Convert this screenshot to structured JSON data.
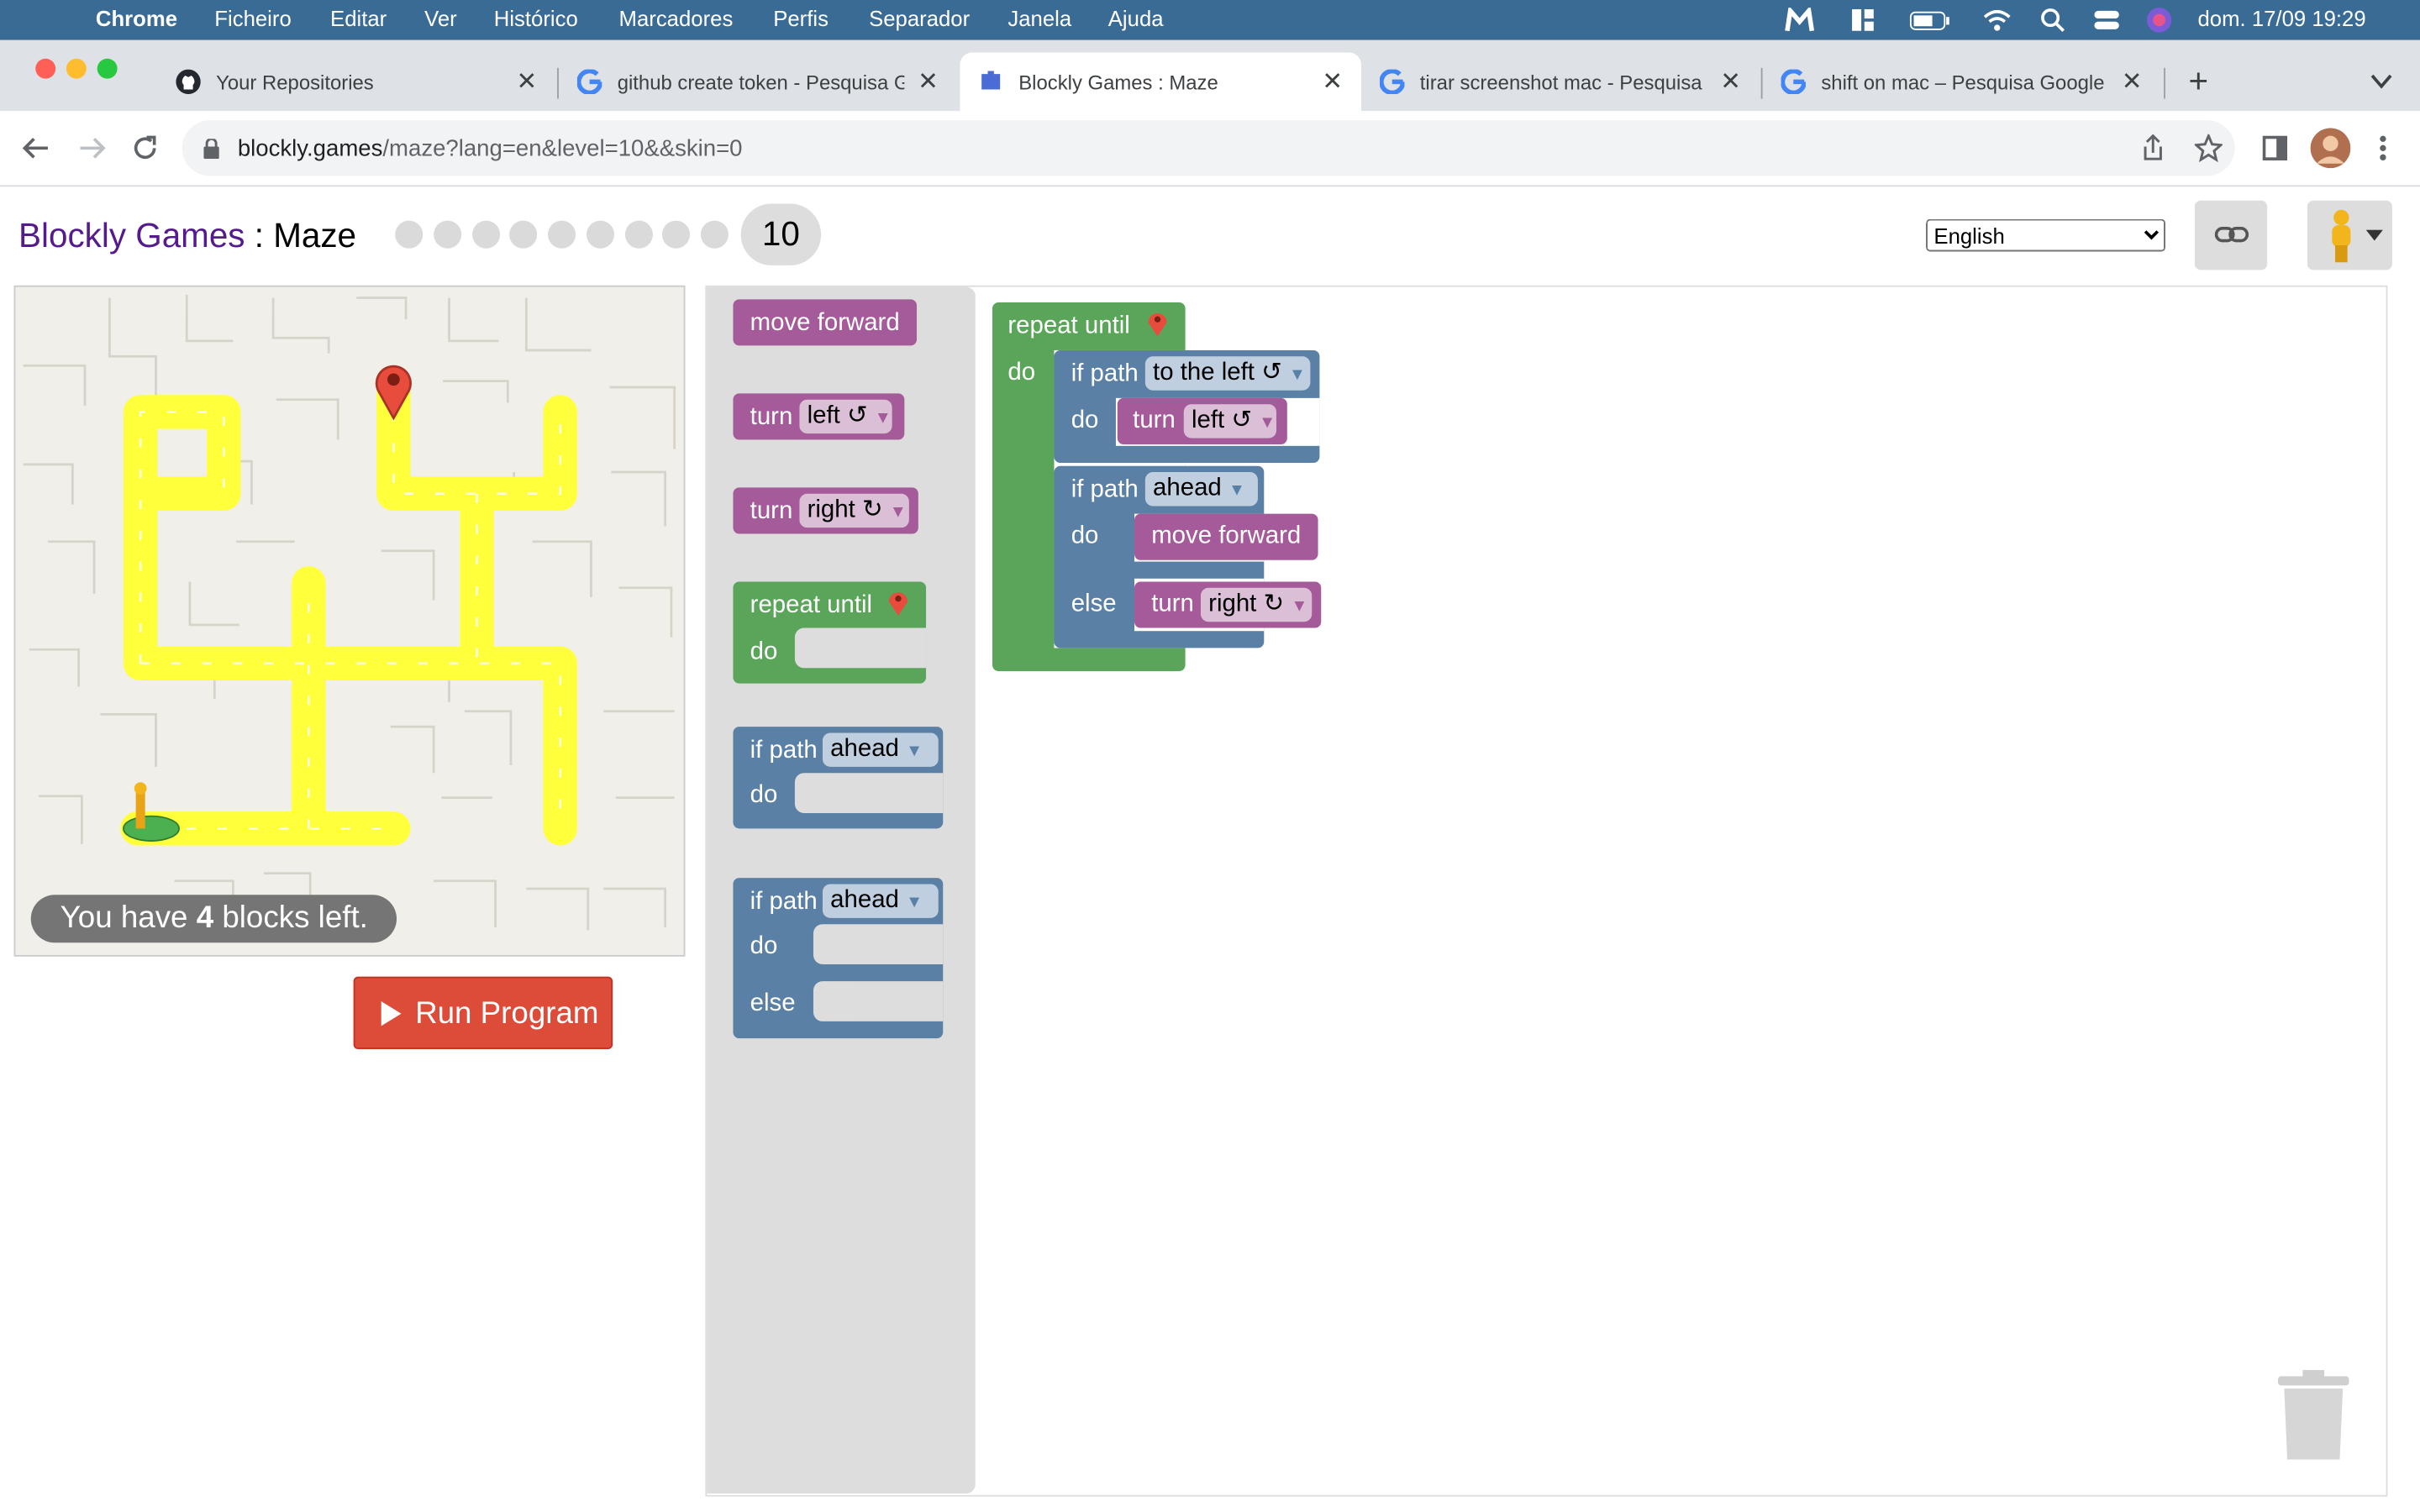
{
  "menubar": {
    "app": "Chrome",
    "items": [
      "Ficheiro",
      "Editar",
      "Ver",
      "Histórico",
      "Marcadores",
      "Perfis",
      "Separador",
      "Janela",
      "Ajuda"
    ],
    "clock": "dom. 17/09  19:29"
  },
  "tabs": [
    {
      "title": "Your Repositories",
      "icon": "github-icon"
    },
    {
      "title": "github create token - Pesquisa Google",
      "icon": "google-icon"
    },
    {
      "title": "Blockly Games : Maze",
      "icon": "blockly-icon",
      "active": true
    },
    {
      "title": "tirar screenshot mac - Pesquisa Google",
      "icon": "google-icon"
    },
    {
      "title": "shift on mac – Pesquisa Google",
      "icon": "google-icon"
    }
  ],
  "toolbar": {
    "url_host": "blockly.games",
    "url_path": "/maze?lang=en&level=10&&skin=0"
  },
  "page": {
    "title_link": "Blockly Games",
    "title_sep": " : ",
    "title_name": "Maze",
    "level": "10",
    "language": "English",
    "capacity_prefix": "You have ",
    "capacity_count": "4",
    "capacity_suffix": " blocks left.",
    "run_label": "Run Program"
  },
  "toolbox": {
    "move_forward": "move forward",
    "turn": "turn",
    "left": "left ↺",
    "right": "right ↻",
    "repeat_until": "repeat until",
    "do": "do",
    "else": "else",
    "if_path": "if path",
    "ahead": "ahead"
  },
  "program": {
    "repeat_until": "repeat until",
    "do": "do",
    "if_path": "if path",
    "to_the_left": "to the left ↺",
    "turn": "turn",
    "left": "left ↺",
    "ahead": "ahead",
    "move_forward": "move forward",
    "else": "else",
    "right": "right ↻"
  },
  "colors": {
    "menubar": "#3a6b95",
    "motion_block": "#a55b99",
    "loop_block": "#5ba55b",
    "logic_block": "#5b80a5",
    "run_button": "#dd4b39",
    "maze_path": "#ffff3c"
  }
}
